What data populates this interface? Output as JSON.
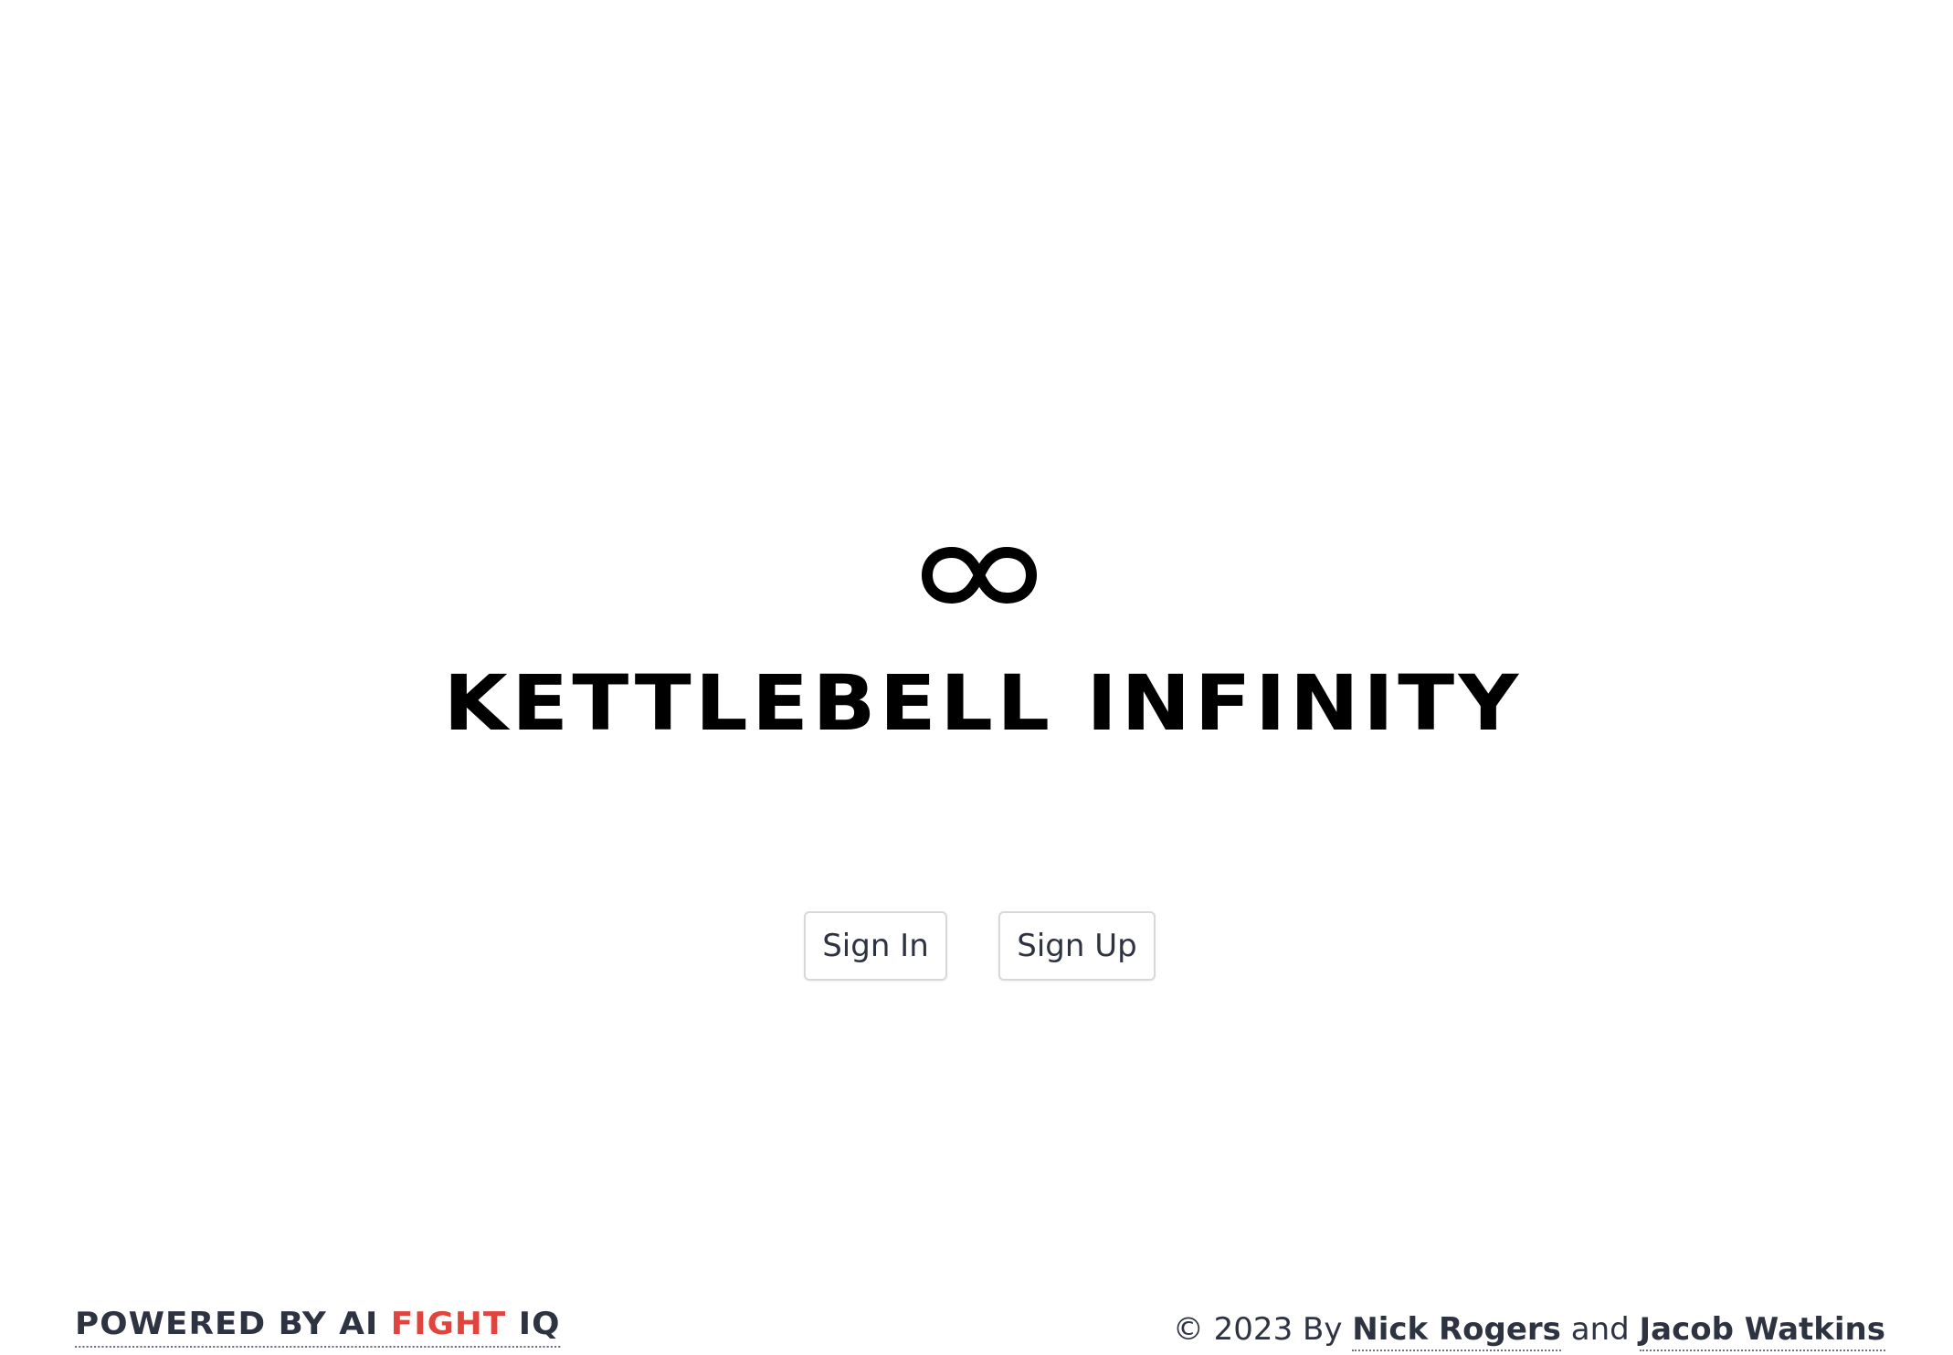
{
  "app": {
    "title": "KETTLEBELL INFINITY",
    "logo_icon": "infinity-icon"
  },
  "auth": {
    "sign_in_label": "Sign In",
    "sign_up_label": "Sign Up"
  },
  "footer": {
    "powered_prefix": "POWERED BY AI ",
    "powered_accent": "FIGHT",
    "powered_suffix": " IQ",
    "copyright_prefix": "© 2023 By ",
    "author_1": "Nick Rogers",
    "joiner": " and ",
    "author_2": "Jacob Watkins"
  },
  "colors": {
    "accent": "#e0443c",
    "text": "#2d3340",
    "title": "#000000",
    "button_border": "#d6d8dc"
  }
}
